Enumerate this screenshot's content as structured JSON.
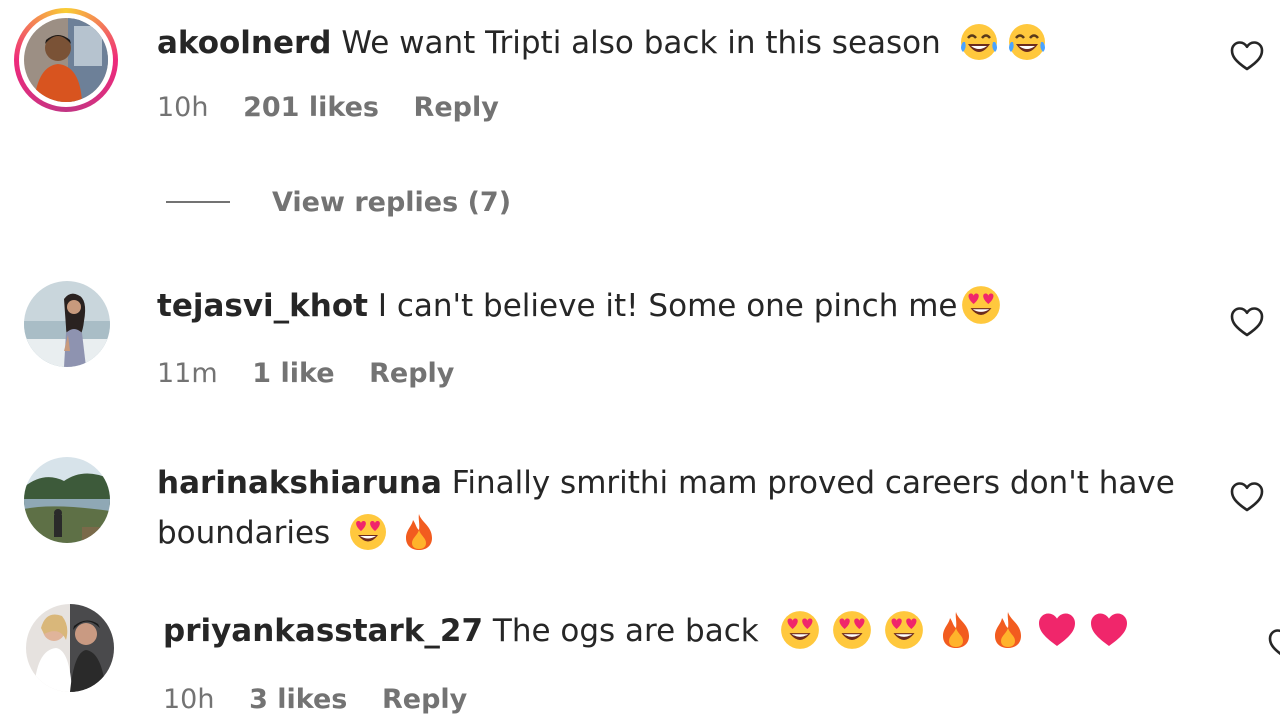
{
  "comments": [
    {
      "username": "akoolnerd",
      "text": "We want Tripti also back in this season",
      "emojis": [
        "face-with-tears-of-joy",
        "face-with-tears-of-joy"
      ],
      "time": "10h",
      "likes": "201 likes",
      "reply": "Reply",
      "has_story_ring": true
    },
    {
      "username": "tejasvi_khot",
      "text": "I can't believe it! Some one pinch me",
      "emojis": [
        "smiling-face-with-heart-eyes"
      ],
      "time": "11m",
      "likes": "1 like",
      "reply": "Reply",
      "has_story_ring": false
    },
    {
      "username": "harinakshiaruna",
      "text": "Finally smrithi mam proved careers don't have",
      "text_line2": "boundaries",
      "emojis": [
        "smiling-face-with-heart-eyes",
        "fire"
      ],
      "has_story_ring": false
    },
    {
      "username": "priyankasstark_27",
      "text": "The ogs are back",
      "emojis": [
        "smiling-face-with-heart-eyes",
        "smiling-face-with-heart-eyes",
        "smiling-face-with-heart-eyes",
        "fire",
        "fire",
        "red-heart",
        "red-heart"
      ],
      "time": "10h",
      "likes": "3 likes",
      "reply": "Reply",
      "has_story_ring": false
    }
  ],
  "view_replies": "View replies (7)",
  "icons": {
    "like": "heart-outline-icon"
  },
  "colors": {
    "text_primary": "#262626",
    "text_secondary": "#737373",
    "story_ring_start": "#f9ce34",
    "story_ring_end": "#c13584"
  }
}
